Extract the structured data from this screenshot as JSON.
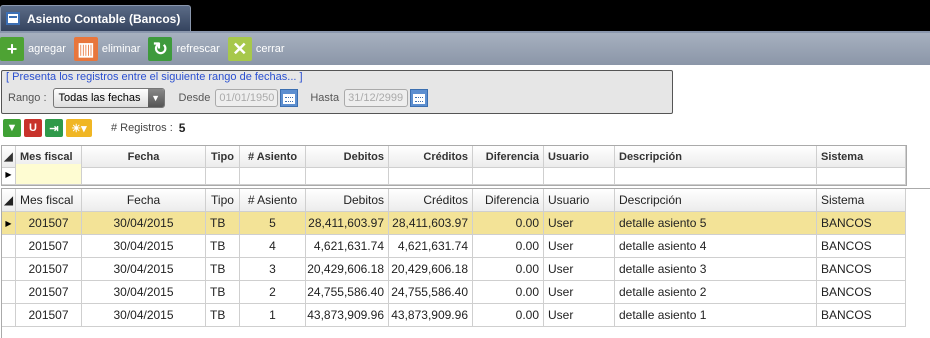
{
  "window": {
    "title": "Asiento Contable (Bancos)"
  },
  "toolbar": [
    {
      "key": "add",
      "label": "agregar",
      "icon": "plus-icon"
    },
    {
      "key": "del",
      "label": "eliminar",
      "icon": "trash-icon"
    },
    {
      "key": "ref",
      "label": "refrescar",
      "icon": "refresh-icon"
    },
    {
      "key": "close",
      "label": "cerrar",
      "icon": "close-doc-icon"
    }
  ],
  "filter": {
    "legend": "[ Presenta los registros entre el siguiente rango de fechas... ]",
    "rango_label": "Rango :",
    "rango_value": "Todas las fechas",
    "desde_label": "Desde",
    "desde_value": "01/01/1950",
    "hasta_label": "Hasta",
    "hasta_value": "31/12/2999"
  },
  "records": {
    "label": "# Registros :",
    "count": "5"
  },
  "columns": [
    "Mes fiscal",
    "Fecha",
    "Tipo",
    "# Asiento",
    "Debitos",
    "Créditos",
    "Diferencia",
    "Usuario",
    "Descripción",
    "Sistema"
  ],
  "rows": [
    [
      "201507",
      "30/04/2015",
      "TB",
      "5",
      "28,411,603.97",
      "28,411,603.97",
      "0.00",
      "User",
      "detalle asiento 5",
      "BANCOS"
    ],
    [
      "201507",
      "30/04/2015",
      "TB",
      "4",
      "4,621,631.74",
      "4,621,631.74",
      "0.00",
      "User",
      "detalle asiento 4",
      "BANCOS"
    ],
    [
      "201507",
      "30/04/2015",
      "TB",
      "3",
      "20,429,606.18",
      "20,429,606.18",
      "0.00",
      "User",
      "detalle asiento 3",
      "BANCOS"
    ],
    [
      "201507",
      "30/04/2015",
      "TB",
      "2",
      "24,755,586.40",
      "24,755,586.40",
      "0.00",
      "User",
      "detalle asiento 2",
      "BANCOS"
    ],
    [
      "201507",
      "30/04/2015",
      "TB",
      "1",
      "43,873,909.96",
      "43,873,909.96",
      "0.00",
      "User",
      "detalle asiento 1",
      "BANCOS"
    ]
  ],
  "colors": {
    "selected_row": "#f3e397",
    "filter_text": "#2a4fd0",
    "toolbar_bg": "#98a3b4"
  }
}
